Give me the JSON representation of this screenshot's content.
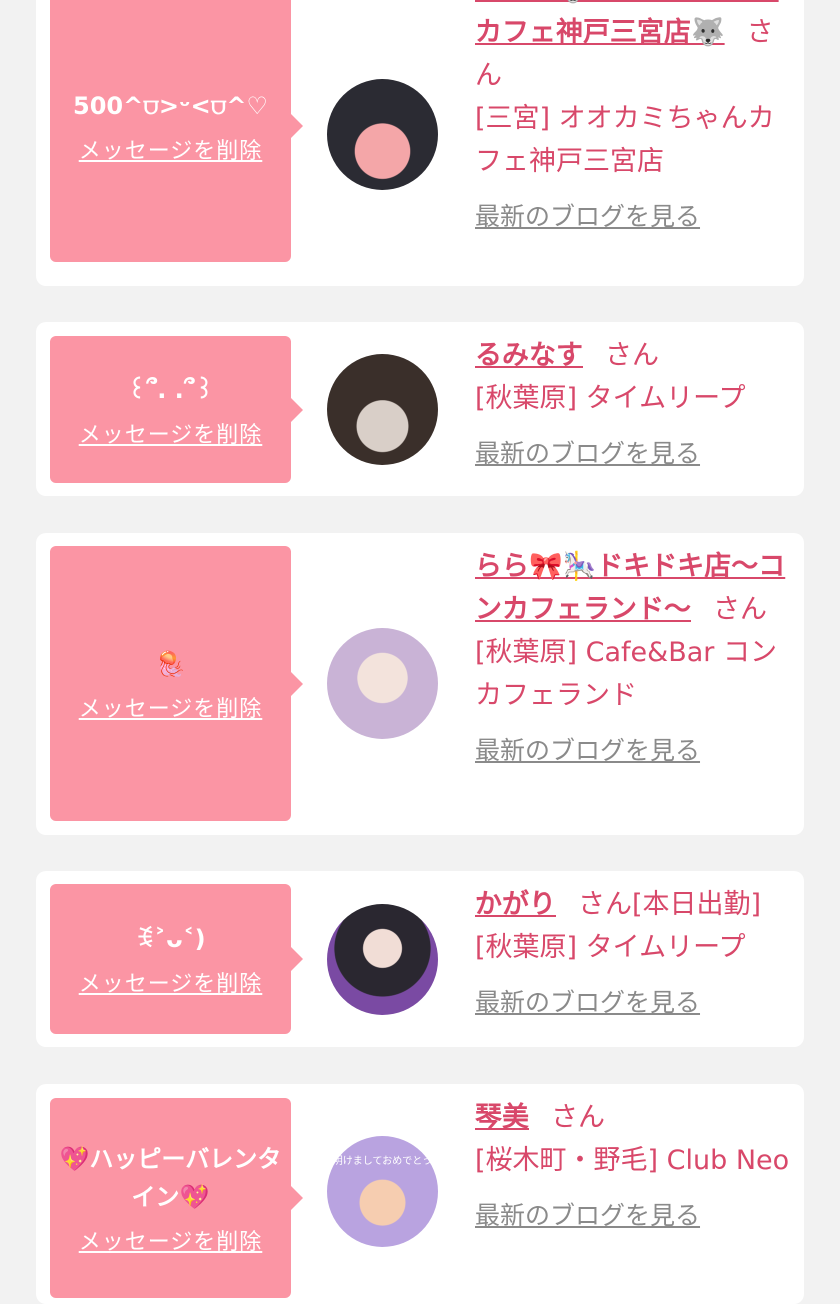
{
  "entries": [
    {
      "message": "500^⩌>ᵕ<⩌^♡",
      "delete_label": "メッセージを削除",
      "name": "にゃみ🐺オオカミちゃんカフェ神戸三宮店🐺",
      "honorific": "さん",
      "extra": "",
      "shop": "[三宮] オオカミちゃんカフェ神戸三宮店",
      "blog_label": "最新のブログを見る",
      "avatar_colors": [
        "#2b2b33",
        "#f4a6a8"
      ]
    },
    {
      "message": "꒰՞. .՞꒱",
      "delete_label": "メッセージを削除",
      "name": "るみなす",
      "honorific": "さん",
      "extra": "",
      "shop": "[秋葉原] タイムリープ",
      "blog_label": "最新のブログを見る",
      "avatar_colors": [
        "#3a2f2a",
        "#d9cfc8"
      ]
    },
    {
      "message": "🪼",
      "delete_label": "メッセージを削除",
      "name": "らら🎀🎠ドキドキ店〜コンカフェランド〜",
      "honorific": "さん",
      "extra": "",
      "shop": "[秋葉原] Cafe&Bar コンカフェランド",
      "blog_label": "最新のブログを見る",
      "avatar_colors": [
        "#c9b3d6",
        "#f3e3dc"
      ]
    },
    {
      "message": "ꉂ˃ᴗ˂)",
      "delete_label": "メッセージを削除",
      "name": "かがり",
      "honorific": "さん",
      "extra": "[本日出勤]",
      "shop": "[秋葉原] タイムリープ",
      "blog_label": "最新のブログを見る",
      "avatar_colors": [
        "#2a2730",
        "#7a4aa3"
      ]
    },
    {
      "message": "💖ハッピーバレンタイン💖",
      "delete_label": "メッセージを削除",
      "name": "琴美",
      "honorific": "さん",
      "extra": "",
      "shop": "[桜木町・野毛] Club Neo",
      "blog_label": "最新のブログを見る",
      "avatar_colors": [
        "#b9a3e0",
        "#f6cdb0"
      ],
      "avatar_text": "明けましておめでとう"
    }
  ]
}
